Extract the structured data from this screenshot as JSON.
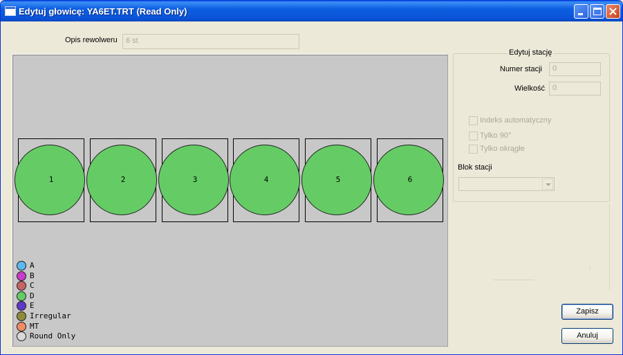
{
  "window": {
    "title": "Edytuj głowicę: YA6ET.TRT (Read Only)"
  },
  "turret": {
    "opis_label": "Opis rewolweru",
    "opis_value": "6 st"
  },
  "stations": [
    {
      "label": "1",
      "color": "#65cc65"
    },
    {
      "label": "2",
      "color": "#65cc65"
    },
    {
      "label": "3",
      "color": "#65cc65"
    },
    {
      "label": "4",
      "color": "#65cc65"
    },
    {
      "label": "5",
      "color": "#65cc65"
    },
    {
      "label": "6",
      "color": "#65cc65"
    }
  ],
  "legend": [
    {
      "label": "A",
      "color": "#5fb8f0"
    },
    {
      "label": "B",
      "color": "#c83cc8"
    },
    {
      "label": "C",
      "color": "#c86464"
    },
    {
      "label": "D",
      "color": "#65cc65"
    },
    {
      "label": "E",
      "color": "#6038c8"
    },
    {
      "label": "Irregular",
      "color": "#8c8c3c"
    },
    {
      "label": "MT",
      "color": "#f08c64"
    },
    {
      "label": "Round Only",
      "color": "#d8d8d8"
    }
  ],
  "edit_station": {
    "group_title": "Edytuj stację",
    "numer_label": "Numer stacji",
    "numer_value": "0",
    "wielkosc_label": "Wielkość",
    "wielkosc_value": "0",
    "checkboxes": [
      {
        "label": "Indeks automatyczny",
        "checked": false
      },
      {
        "label": "Tylko 90°",
        "checked": false
      },
      {
        "label": "Tylko okrągłe",
        "checked": false
      }
    ],
    "blok_label": "Blok stacji",
    "blok_value": ""
  },
  "buttons": {
    "save": "Zapisz",
    "cancel": "Anuluj"
  }
}
